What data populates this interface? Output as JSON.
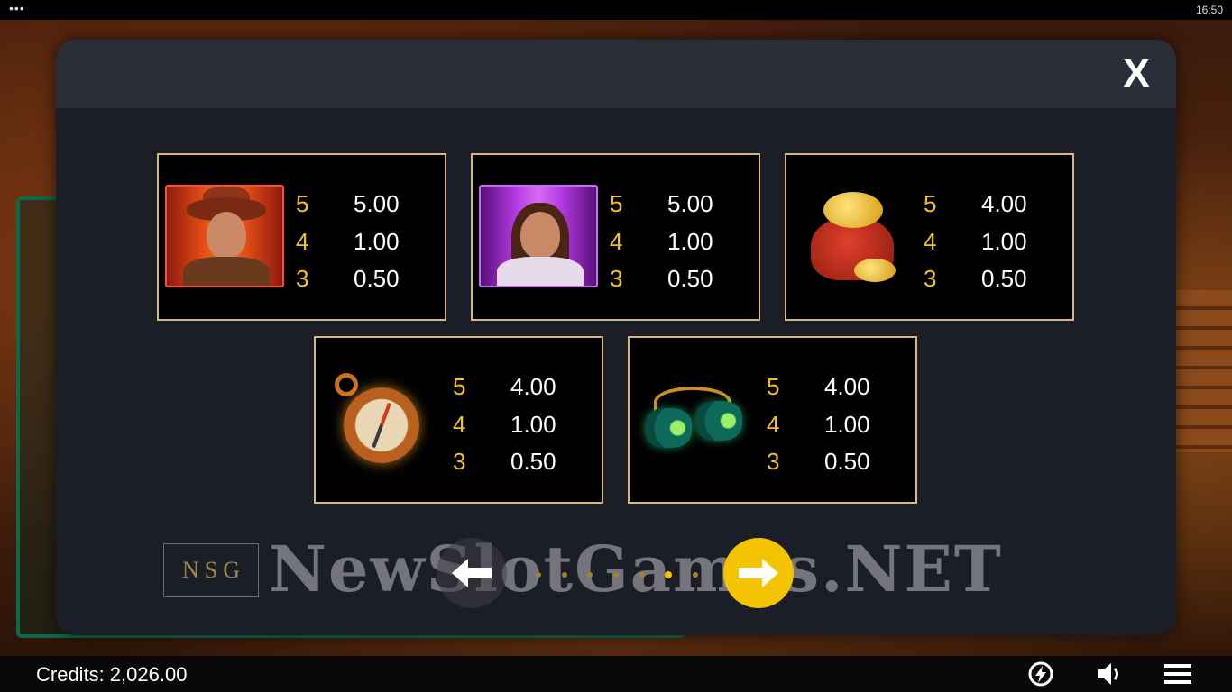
{
  "system_bar": {
    "menu_dots": "•••",
    "clock": "16:50"
  },
  "modal": {
    "close_label": "X"
  },
  "paytable": [
    {
      "symbol": "explorer-man-symbol",
      "rows": [
        {
          "count": "5",
          "value": "5.00"
        },
        {
          "count": "4",
          "value": "1.00"
        },
        {
          "count": "3",
          "value": "0.50"
        }
      ]
    },
    {
      "symbol": "explorer-woman-symbol",
      "rows": [
        {
          "count": "5",
          "value": "5.00"
        },
        {
          "count": "4",
          "value": "1.00"
        },
        {
          "count": "3",
          "value": "0.50"
        }
      ]
    },
    {
      "symbol": "gold-bag-symbol",
      "rows": [
        {
          "count": "5",
          "value": "4.00"
        },
        {
          "count": "4",
          "value": "1.00"
        },
        {
          "count": "3",
          "value": "0.50"
        }
      ]
    },
    {
      "symbol": "compass-symbol",
      "rows": [
        {
          "count": "5",
          "value": "4.00"
        },
        {
          "count": "4",
          "value": "1.00"
        },
        {
          "count": "3",
          "value": "0.50"
        }
      ]
    },
    {
      "symbol": "binoculars-symbol",
      "rows": [
        {
          "count": "5",
          "value": "4.00"
        },
        {
          "count": "4",
          "value": "1.00"
        },
        {
          "count": "3",
          "value": "0.50"
        }
      ]
    }
  ],
  "pagination": {
    "total_pages": 7,
    "active_page": 6
  },
  "watermark": {
    "logo_letters": [
      "N",
      "S",
      "G"
    ],
    "text": "NewSlotGames.NET"
  },
  "footer": {
    "credits_label": "Credits:",
    "credits_value": "2,026.00"
  },
  "colors": {
    "accent": "#f5c400",
    "card_border": "#d8b87a",
    "pay_count": "#f2c21a",
    "modal_bg": "#1b1e26"
  }
}
